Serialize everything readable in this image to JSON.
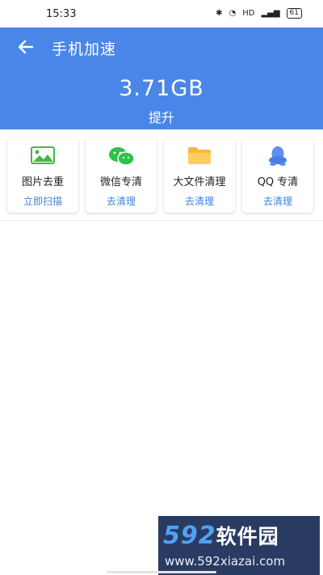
{
  "status_bar": {
    "time": "15:33",
    "network": "HD",
    "battery": "61"
  },
  "header": {
    "title": "手机加速",
    "size_value": "3.71GB",
    "size_label": "提升"
  },
  "cards": [
    {
      "icon": "image-icon",
      "name": "图片去重",
      "action": "立即扫描"
    },
    {
      "icon": "wechat-icon",
      "name": "微信专清",
      "action": "去清理"
    },
    {
      "icon": "folder-icon",
      "name": "大文件清理",
      "action": "去清理"
    },
    {
      "icon": "qq-icon",
      "name": "QQ 专清",
      "action": "去清理"
    }
  ],
  "watermark": {
    "brand_num": "592",
    "brand_text": "软件园",
    "url": "www.592xiazai.com"
  },
  "colors": {
    "primary": "#4a86e8",
    "action_text": "#3f83d9"
  }
}
